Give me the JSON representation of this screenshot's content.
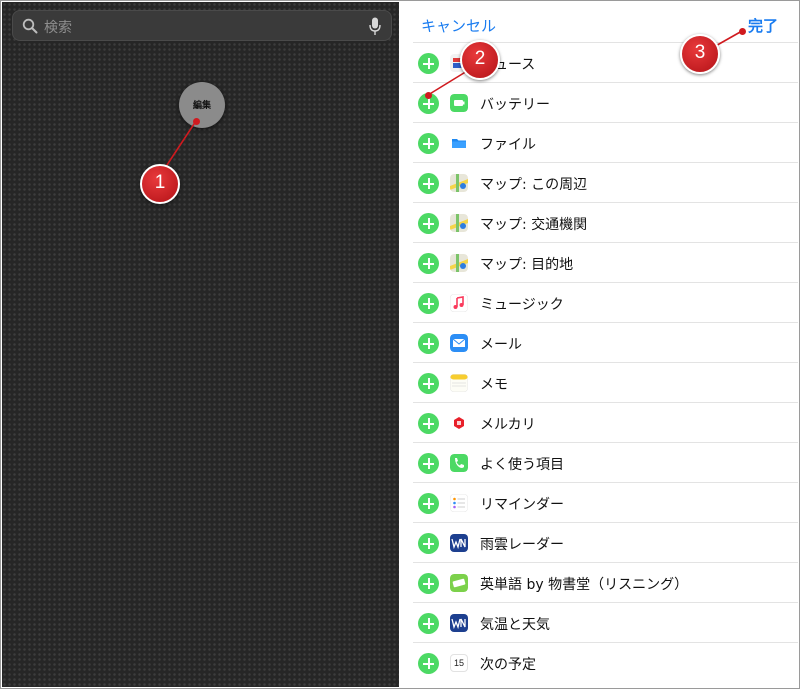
{
  "colors": {
    "accent": "#1a7cf0",
    "add_green": "#4cd964",
    "callout_red": "#d01a1f",
    "left_background": "#262626"
  },
  "left_panel": {
    "search_placeholder": "検索",
    "search_icon": "search-icon",
    "mic_icon": "mic-icon",
    "edit_label": "編集"
  },
  "right_panel": {
    "cancel_label": "キャンセル",
    "done_label": "完了",
    "items": [
      {
        "label": "ニュース",
        "icon": "news-icon"
      },
      {
        "label": "バッテリー",
        "icon": "battery-icon"
      },
      {
        "label": "ファイル",
        "icon": "files-icon"
      },
      {
        "label": "マップ: この周辺",
        "icon": "maps-icon"
      },
      {
        "label": "マップ: 交通機関",
        "icon": "maps-icon"
      },
      {
        "label": "マップ: 目的地",
        "icon": "maps-icon"
      },
      {
        "label": "ミュージック",
        "icon": "music-icon"
      },
      {
        "label": "メール",
        "icon": "mail-icon"
      },
      {
        "label": "メモ",
        "icon": "notes-icon"
      },
      {
        "label": "メルカリ",
        "icon": "mercari-icon"
      },
      {
        "label": "よく使う項目",
        "icon": "phone-icon"
      },
      {
        "label": "リマインダー",
        "icon": "reminders-icon"
      },
      {
        "label": "雨雲レーダー",
        "icon": "weathernews-icon"
      },
      {
        "label": "英単語 by 物書堂（リスニング）",
        "icon": "vocab-icon"
      },
      {
        "label": "気温と天気",
        "icon": "weathernews-icon"
      },
      {
        "label": "次の予定",
        "icon": "calendar-icon"
      }
    ],
    "calendar_day": "15"
  },
  "callouts": [
    "1",
    "2",
    "3"
  ]
}
